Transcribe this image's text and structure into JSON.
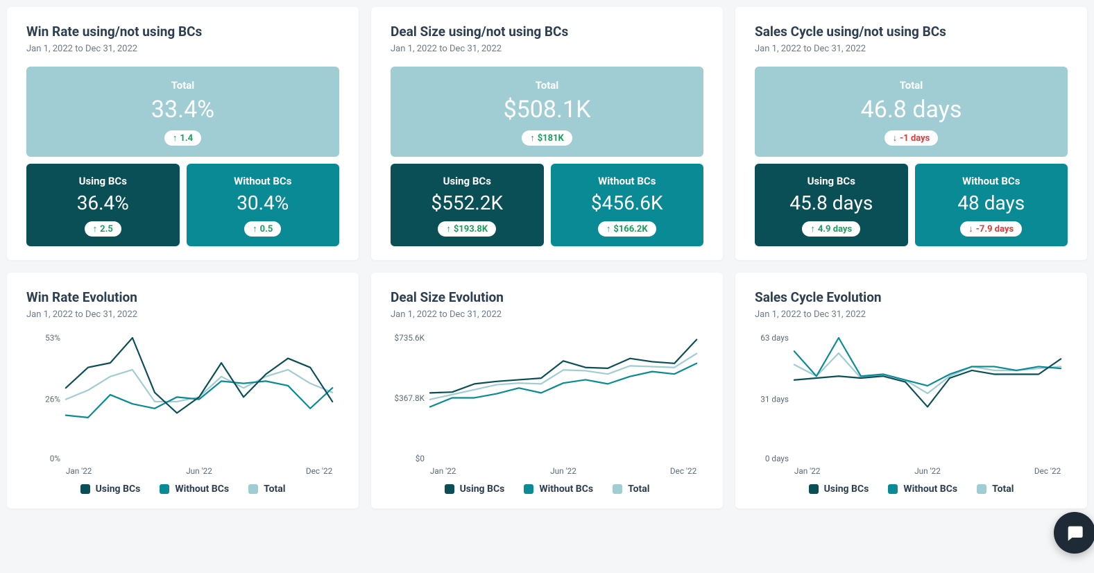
{
  "daterange": {
    "from": "Jan 1, 2022",
    "sep": "to",
    "to": "Dec 31, 2022"
  },
  "labels": {
    "total": "Total",
    "using": "Using BCs",
    "without": "Without BCs"
  },
  "legend": {
    "using": "Using BCs",
    "without": "Without BCs",
    "total": "Total"
  },
  "colors": {
    "dark": "#0a4e56",
    "mid": "#0a8a95",
    "light": "#9fcdd3",
    "up": "#1a9e5c",
    "down": "#d93a3a"
  },
  "kpis": [
    {
      "title": "Win Rate using/not using BCs",
      "total": {
        "value": "33.4%",
        "pill_dir": "up",
        "pill_text": "1.4"
      },
      "using": {
        "value": "36.4%",
        "pill_dir": "up",
        "pill_text": "2.5"
      },
      "without": {
        "value": "30.4%",
        "pill_dir": "up",
        "pill_text": "0.5"
      }
    },
    {
      "title": "Deal Size using/not using BCs",
      "total": {
        "value": "$508.1K",
        "pill_dir": "up",
        "pill_text": "$181K"
      },
      "using": {
        "value": "$552.2K",
        "pill_dir": "up",
        "pill_text": "$193.8K"
      },
      "without": {
        "value": "$456.6K",
        "pill_dir": "up",
        "pill_text": "$166.2K"
      }
    },
    {
      "title": "Sales Cycle using/not using BCs",
      "total": {
        "value": "46.8 days",
        "pill_dir": "down",
        "pill_text": "-1 days"
      },
      "using": {
        "value": "45.8 days",
        "pill_dir": "up",
        "pill_text": "4.9 days"
      },
      "without": {
        "value": "48 days",
        "pill_dir": "down",
        "pill_text": "-7.9 days"
      }
    }
  ],
  "charts": [
    {
      "title": "Win Rate Evolution",
      "y_ticks": [
        "53%",
        "26%",
        "0%"
      ],
      "x_ticks": [
        "Jan '22",
        "Jun '22",
        "Dec '22"
      ]
    },
    {
      "title": "Deal Size Evolution",
      "y_ticks": [
        "$735.6K",
        "$367.8K",
        "$0"
      ],
      "x_ticks": [
        "Jan '22",
        "Jun '22",
        "Dec '22"
      ]
    },
    {
      "title": "Sales Cycle Evolution",
      "y_ticks": [
        "63 days",
        "31 days",
        "0 days"
      ],
      "x_ticks": [
        "Jan '22",
        "Jun '22",
        "Dec '22"
      ]
    }
  ],
  "chart_data": [
    {
      "type": "line",
      "title": "Win Rate Evolution",
      "xlabel": "",
      "ylabel": "",
      "ylim": [
        0,
        53
      ],
      "y_ticks": [
        0,
        26,
        53
      ],
      "categories": [
        "Jan",
        "Feb",
        "Mar",
        "Apr",
        "May",
        "Jun",
        "Jul",
        "Aug",
        "Sep",
        "Oct",
        "Nov",
        "Dec"
      ],
      "x_tick_labels": [
        "Jan '22",
        "Jun '22",
        "Dec '22"
      ],
      "series": [
        {
          "name": "Using BCs",
          "color": "#0a4e56",
          "values": [
            31,
            40,
            42,
            53,
            29,
            20,
            27,
            42,
            27,
            37,
            44,
            40,
            25
          ]
        },
        {
          "name": "Without BCs",
          "color": "#0a8a95",
          "values": [
            19,
            18,
            28,
            24,
            22,
            27,
            26,
            34,
            33,
            34,
            32,
            22,
            31
          ]
        },
        {
          "name": "Total",
          "color": "#9fcdd3",
          "values": [
            26,
            30,
            36,
            39,
            25,
            25,
            27,
            36,
            31,
            36,
            39,
            33,
            29
          ]
        }
      ]
    },
    {
      "type": "line",
      "title": "Deal Size Evolution",
      "xlabel": "",
      "ylabel": "",
      "ylim": [
        0,
        735.6
      ],
      "y_ticks": [
        0,
        367.8,
        735.6
      ],
      "categories": [
        "Jan",
        "Feb",
        "Mar",
        "Apr",
        "May",
        "Jun",
        "Jul",
        "Aug",
        "Sep",
        "Oct",
        "Nov",
        "Dec"
      ],
      "x_tick_labels": [
        "Jan '22",
        "Jun '22",
        "Dec '22"
      ],
      "series": [
        {
          "name": "Using BCs",
          "color": "#0a4e56",
          "values": [
            400,
            405,
            455,
            470,
            480,
            490,
            595,
            555,
            550,
            610,
            590,
            580,
            725
          ]
        },
        {
          "name": "Without BCs",
          "color": "#0a8a95",
          "values": [
            315,
            370,
            370,
            395,
            430,
            400,
            460,
            480,
            455,
            500,
            530,
            515,
            580
          ]
        },
        {
          "name": "Total",
          "color": "#9fcdd3",
          "values": [
            360,
            390,
            420,
            450,
            460,
            455,
            540,
            535,
            515,
            565,
            560,
            555,
            640
          ]
        }
      ]
    },
    {
      "type": "line",
      "title": "Sales Cycle Evolution",
      "xlabel": "",
      "ylabel": "",
      "ylim": [
        0,
        63
      ],
      "y_ticks": [
        0,
        31,
        63
      ],
      "categories": [
        "Jan",
        "Feb",
        "Mar",
        "Apr",
        "May",
        "Jun",
        "Jul",
        "Aug",
        "Sep",
        "Oct",
        "Nov",
        "Dec"
      ],
      "x_tick_labels": [
        "Jan '22",
        "Jun '22",
        "Dec '22"
      ],
      "series": [
        {
          "name": "Using BCs",
          "color": "#0a4e56",
          "values": [
            41,
            42,
            43,
            42,
            43,
            40,
            27,
            42,
            46,
            44,
            44,
            44,
            52
          ]
        },
        {
          "name": "Without BCs",
          "color": "#0a8a95",
          "values": [
            56,
            43,
            63,
            43,
            44,
            41,
            38,
            44,
            48,
            48,
            46,
            48,
            47
          ]
        },
        {
          "name": "Total",
          "color": "#9fcdd3",
          "values": [
            49,
            43,
            55,
            42,
            44,
            41,
            34,
            43,
            48,
            46,
            46,
            47,
            48
          ]
        }
      ]
    }
  ]
}
